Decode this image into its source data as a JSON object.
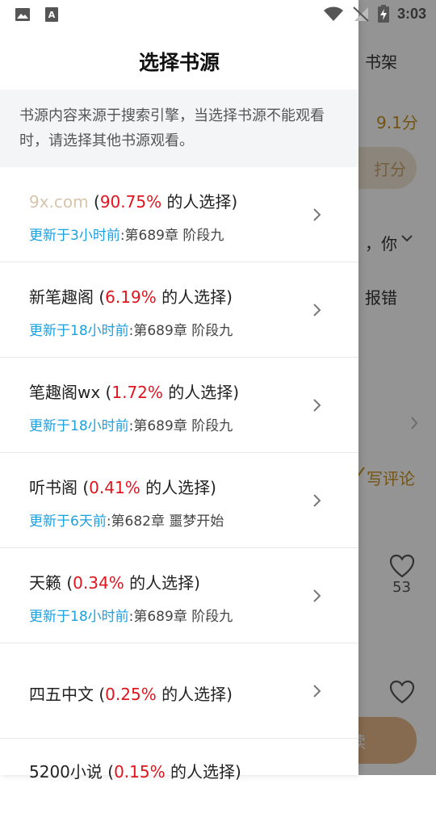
{
  "status_bar": {
    "time": "3:03"
  },
  "background": {
    "bookshelf_label": "书架",
    "score": "9.1分",
    "rate_button": "打分",
    "partial_text": "，你",
    "report_label": "报错",
    "write_review": "写评论",
    "like_count": "53",
    "read_button_partial": "读"
  },
  "drawer": {
    "title": "选择书源",
    "notice": "书源内容来源于搜索引擎，当选择书源不能观看时，请选择其他书源观看。",
    "sources": [
      {
        "name": "9x.com",
        "percent": "90.75%",
        "suffix": " 的人选择)",
        "updated": "更新于3小时前",
        "chapter": ":第689章 阶段九"
      },
      {
        "name": "新笔趣阁",
        "percent": "6.19%",
        "suffix": " 的人选择)",
        "updated": "更新于18小时前",
        "chapter": ":第689章 阶段九"
      },
      {
        "name": "笔趣阁wx",
        "percent": "1.72%",
        "suffix": " 的人选择)",
        "updated": "更新于18小时前",
        "chapter": ":第689章 阶段九"
      },
      {
        "name": "听书阁",
        "percent": "0.41%",
        "suffix": " 的人选择)",
        "updated": "更新于6天前",
        "chapter": ":第682章 噩梦开始"
      },
      {
        "name": "天籁",
        "percent": "0.34%",
        "suffix": " 的人选择)",
        "updated": "更新于18小时前",
        "chapter": ":第689章 阶段九"
      },
      {
        "name": "四五中文",
        "percent": "0.25%",
        "suffix": " 的人选择)",
        "updated": "",
        "chapter": ""
      },
      {
        "name": "5200小说",
        "percent": "0.15%",
        "suffix": " 的人选择)",
        "updated": "",
        "chapter": ""
      }
    ]
  }
}
